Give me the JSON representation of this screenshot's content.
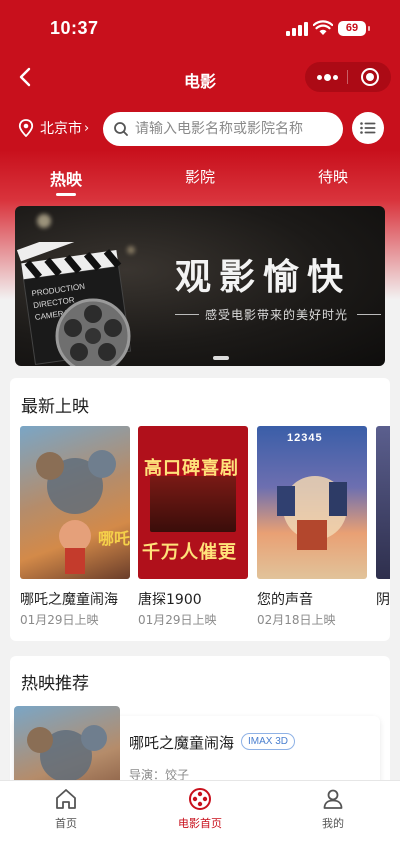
{
  "status_bar": {
    "time": "10:37",
    "battery": "69"
  },
  "nav": {
    "title": "电影"
  },
  "location": {
    "city": "北京市",
    "arrow": "›"
  },
  "search": {
    "placeholder": "请输入电影名称或影院名称"
  },
  "tabs": [
    {
      "label": "热映",
      "active": true
    },
    {
      "label": "影院",
      "active": false
    },
    {
      "label": "待映",
      "active": false
    }
  ],
  "banner": {
    "title": "观影愉快",
    "subtitle": "感受电影带来的美好时光"
  },
  "latest": {
    "title": "最新上映",
    "movies": [
      {
        "name": "哪吒之魔童闹海",
        "date": "01月29日上映"
      },
      {
        "name": "唐探1900",
        "date": "01月29日上映",
        "poster_text_top": "高口碑喜剧",
        "poster_text_bottom": "千万人催更"
      },
      {
        "name": "您的声音",
        "date": "02月18日上映",
        "poster_text": "12345"
      },
      {
        "name": "阴",
        "date": ""
      }
    ]
  },
  "hot": {
    "title": "热映推荐",
    "item": {
      "name": "哪吒之魔童闹海",
      "badge": "IMAX 3D",
      "director": "导演：饺子"
    }
  },
  "tabbar": [
    {
      "label": "首页",
      "icon": "home-icon",
      "active": false
    },
    {
      "label": "电影首页",
      "icon": "film-reel-icon",
      "active": true
    },
    {
      "label": "我的",
      "icon": "user-icon",
      "active": false
    }
  ],
  "colors": {
    "brand_red": "#c8101c",
    "background": "#f2f2f2",
    "muted_text": "#8a8a8a"
  }
}
